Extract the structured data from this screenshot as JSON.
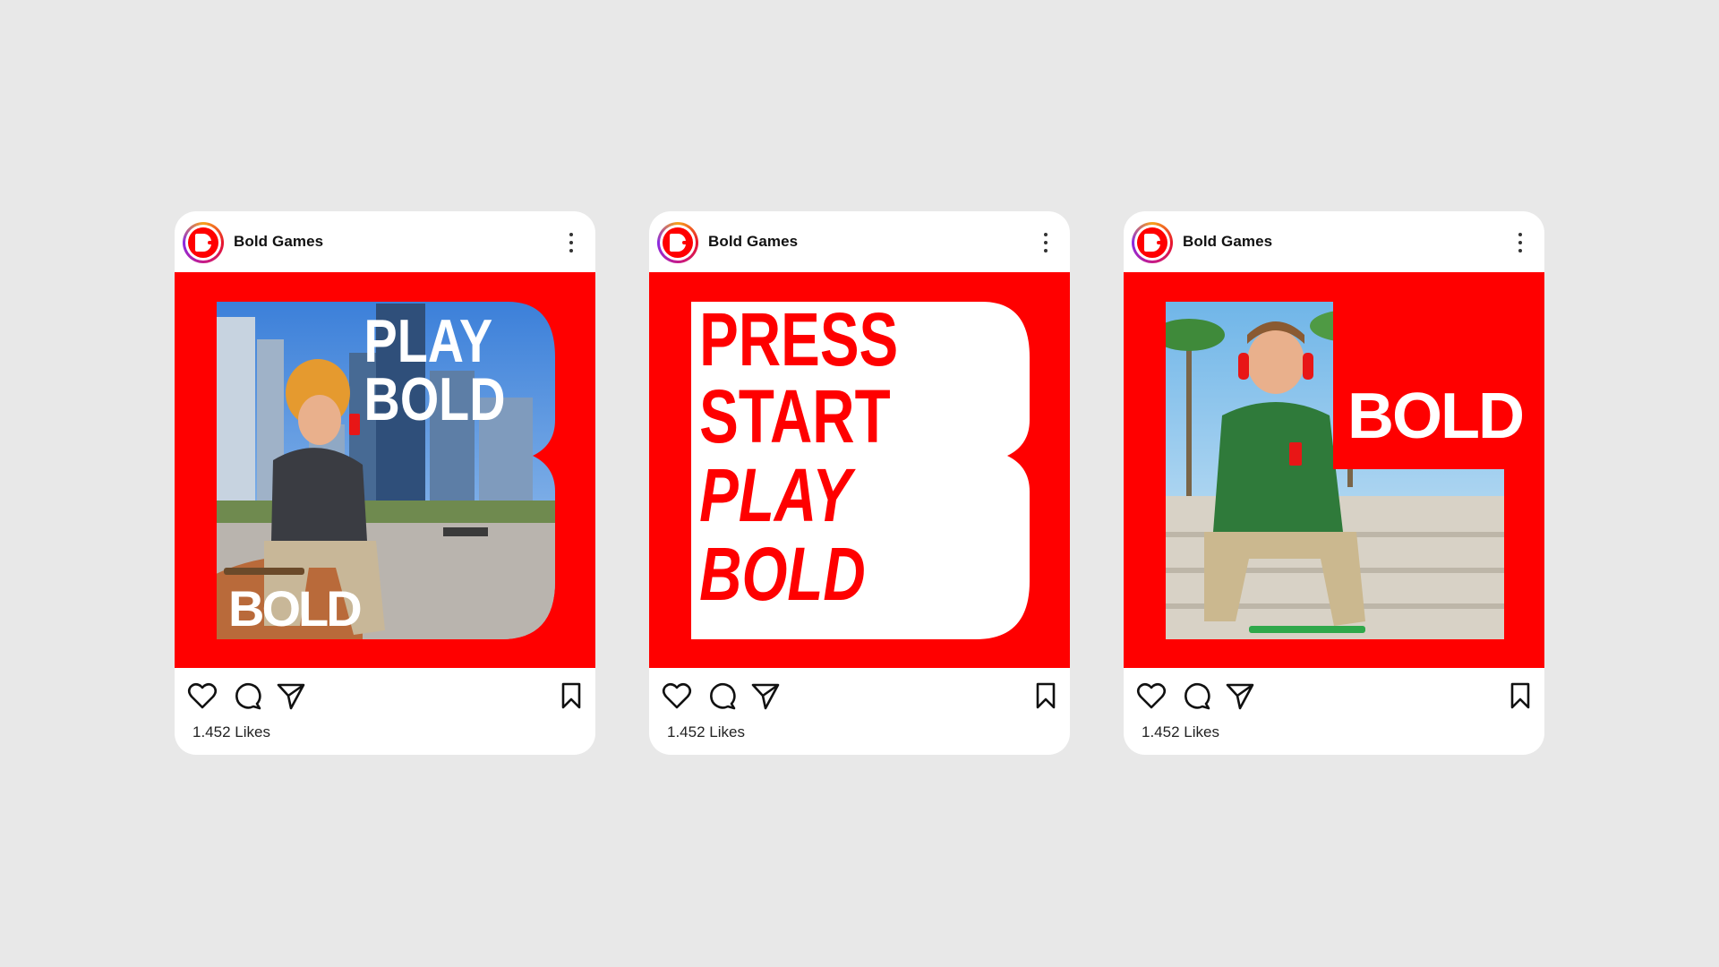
{
  "brand": {
    "accent_color": "#ff0000",
    "background_color": "#e8e8e8"
  },
  "posts": [
    {
      "account": "Bold Games",
      "headline_lines": [
        "PLAY",
        "BOLD"
      ],
      "logo_word": "BOLD",
      "likes": "1.452 Likes"
    },
    {
      "account": "Bold Games",
      "headline_lines": [
        "PRESS",
        "START",
        "PLAY",
        "BOLD"
      ],
      "likes": "1.452 Likes"
    },
    {
      "account": "Bold Games",
      "logo_word": "BOLD",
      "likes": "1.452 Likes"
    }
  ],
  "icons": {
    "avatar": "bold-b-logo-icon",
    "menu": "more-vertical-icon",
    "like": "heart-icon",
    "comment": "comment-bubble-icon",
    "share": "send-plane-icon",
    "save": "bookmark-icon"
  }
}
